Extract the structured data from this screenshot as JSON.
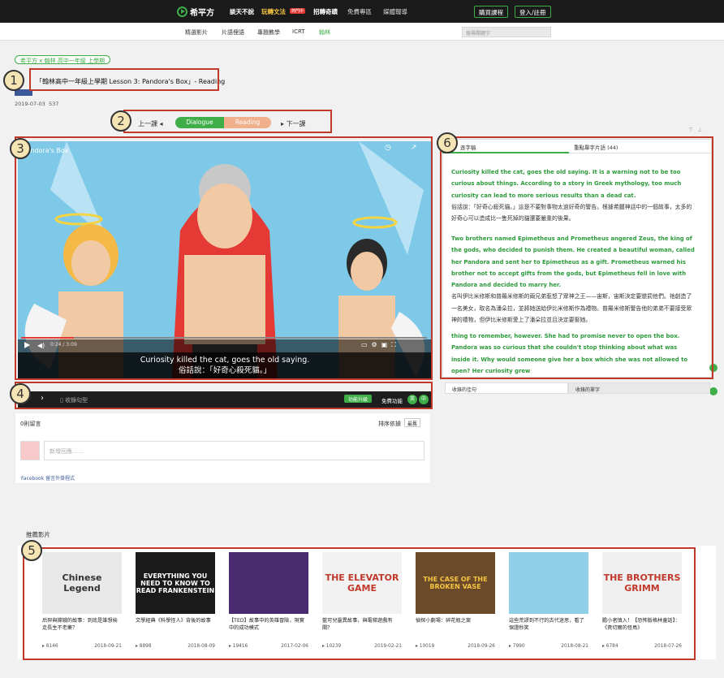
{
  "topbar": {
    "logo": "希平方",
    "nav": [
      "談天不說",
      "玩轉文法",
      "招轉奇蹟",
      "免費專區",
      "媒體報導"
    ],
    "hot_badge": "熱門中",
    "buy_button": "購買課程",
    "login_button": "登入/註冊"
  },
  "subnav": {
    "items": [
      "精選影片",
      "片語俚語",
      "專題教學",
      "ICRT",
      "翰林"
    ],
    "search_placeholder": "搜尋關鍵字"
  },
  "header": {
    "breadcrumb": "希平方 x 翰林 高中一年級 上學期",
    "title": "「翰林高中一年級上學期 Lesson 3: Pandora's Box」- Reading",
    "date": "2019-07-03",
    "views": "537"
  },
  "lesson_nav": {
    "prev": "上一課",
    "next": "下一課",
    "tab_dialogue": "Dialogue",
    "tab_reading": "Reading"
  },
  "video": {
    "title": "Pandora's Box",
    "time": "0:24 / 3:09",
    "subtitle_en": "Curiosity killed the cat, goes the old saying.",
    "subtitle_zh": "俗話說：「好奇心殺死貓。」",
    "progress": 0.13
  },
  "video_bar": {
    "collect": "收錄句型",
    "upgrade": "功能升級",
    "free_function": "免費功能",
    "lang_en": "英",
    "lang_zh": "中"
  },
  "comments": {
    "count_label": "0則留言",
    "sort_label": "排序依據",
    "sort_value": "最舊",
    "input_placeholder": "新增回應……",
    "fb_plugin": "Facebook 留言外掛程式"
  },
  "transcript": {
    "tab_full": "逐字稿",
    "tab_vocab": "重點單字片語 (44)",
    "paragraphs": [
      {
        "en": "Curiosity killed the cat, goes the old saying. It is a warning not to be too curious about things. According to a story in Greek mythology, too much curiosity can lead to more serious results than a dead cat.",
        "zh": "俗話說：「好奇心殺死貓。」這是不要對事物太過好奇的警告。根據希臘神話中的一個故事，太多的好奇心可以造成比一隻死掉的貓還要嚴重的後果。"
      },
      {
        "en": "Two brothers named Epimetheus and Prometheus angered Zeus, the king of the gods, who decided to punish them. He created a beautiful woman, called her Pandora and sent her to Epimetheus as a gift. Prometheus warned his brother not to accept gifts from the gods, but Epimetheus fell in love with Pandora and decided to marry her.",
        "zh": "名叫伊比米修斯和普羅米修斯的兩兄弟惹怒了眾神之王——宙斯，宙斯決定要懲罰他們。祂創造了一名美女，取名為潘朵拉，並將她送給伊比米修斯作為禮物。普羅米修斯警告他的弟弟不要接受眾神的禮物，但伊比米修斯愛上了潘朵拉並且決定要娶她。"
      },
      {
        "en": "thing to remember, however. She had to promise never to open the box. Pandora was so curious that she couldn't stop thinking about what was inside it. Why would someone give her a box which she was not allowed to open? Her curiosity grew",
        "zh": ""
      }
    ],
    "bottom_tab_sentences": "收錄的佳句",
    "bottom_tab_vocab": "收錄的單字"
  },
  "recommended": {
    "title": "推薦影片",
    "cards": [
      {
        "thumb_text": "Chinese Legend",
        "title": "后羿與嫦娥的故事：到底是誰想偷走長生不老藥？",
        "views": "8146",
        "date": "2018-09-21",
        "bg": "#e8e8e8",
        "fg": "#333"
      },
      {
        "thumb_text": "EVERYTHING YOU NEED TO KNOW TO READ FRANKENSTEIN",
        "title": "文學經典《科學怪人》背後的故事",
        "views": "8898",
        "date": "2018-08-09",
        "bg": "#1a1a1a",
        "fg": "#fff"
      },
      {
        "thumb_text": "",
        "title": "【TED】故事中的英雄冒險，現實中的成功模式",
        "views": "19416",
        "date": "2017-02-06",
        "bg": "#4a2a6e",
        "fg": "#fff"
      },
      {
        "thumb_text": "THE ELEVATOR GAME",
        "title": "藍可兒靈異故事，與電梯遊戲有關？",
        "views": "10239",
        "date": "2019-02-21",
        "bg": "#f2f2f2",
        "fg": "#c0392b"
      },
      {
        "thumb_text": "THE CASE OF THE BROKEN VASE",
        "title": "偵探小劇場：碎花瓶之案",
        "views": "10019",
        "date": "2018-09-26",
        "bg": "#6b4a2a",
        "fg": "#f5c542"
      },
      {
        "thumb_text": "",
        "title": "這些荒謬到不行的古代迷思，看了保證秒笑",
        "views": "7990",
        "date": "2018-08-21",
        "bg": "#8fd0e8",
        "fg": "#333"
      },
      {
        "thumb_text": "THE BROTHERS GRIMM",
        "title": "膽小者慎入！【恐怖版格林童話】：《貴切爾的怪鳥》",
        "views": "6784",
        "date": "2018-07-26",
        "bg": "#f0f0f0",
        "fg": "#c0392b"
      }
    ]
  },
  "annotations": [
    "1",
    "2",
    "3",
    "4",
    "5",
    "6"
  ],
  "colors": {
    "brand_green": "#3fae49",
    "reading_orange": "#f0b08c",
    "annotation_red": "#c0392b"
  }
}
